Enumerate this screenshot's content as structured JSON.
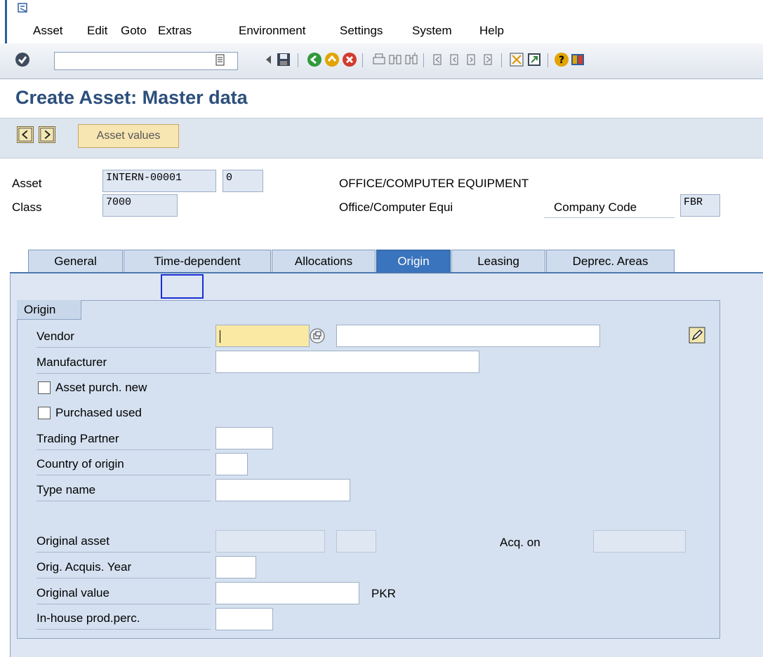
{
  "menu": {
    "items": [
      "Asset",
      "Edit",
      "Goto",
      "Extras",
      "Environment",
      "Settings",
      "System",
      "Help"
    ]
  },
  "toolbar": {
    "command_field_value": "",
    "icons": [
      "enter-icon",
      "command-menu-icon",
      "back-arrow-icon",
      "save-icon",
      "back-icon",
      "exit-icon",
      "cancel-icon",
      "print-icon",
      "find-icon",
      "find-next-icon",
      "first-page-icon",
      "previous-page-icon",
      "next-page-icon",
      "last-page-icon",
      "create-session-icon",
      "shortcut-icon",
      "help-icon",
      "customize-layout-icon"
    ]
  },
  "title": "Create Asset: Master data",
  "app_toolbar": {
    "asset_values_label": "Asset values"
  },
  "header": {
    "asset_label": "Asset",
    "asset_value": "INTERN-00001",
    "asset_subnumber": "0",
    "asset_description": "OFFICE/COMPUTER EQUIPMENT",
    "class_label": "Class",
    "class_value": "7000",
    "class_description": "Office/Computer Equi",
    "company_code_label": "Company Code",
    "company_code_value": "FBR"
  },
  "tabs": [
    {
      "label": "General",
      "active": false
    },
    {
      "label": "Time-dependent",
      "active": false
    },
    {
      "label": "Allocations",
      "active": false
    },
    {
      "label": "Origin",
      "active": true
    },
    {
      "label": "Leasing",
      "active": false
    },
    {
      "label": "Deprec. Areas",
      "active": false
    }
  ],
  "origin": {
    "group_title": "Origin",
    "vendor_label": "Vendor",
    "vendor_value": "",
    "vendor_name": "",
    "manufacturer_label": "Manufacturer",
    "manufacturer_value": "",
    "asset_purch_new_label": "Asset purch. new",
    "purchased_used_label": "Purchased used",
    "trading_partner_label": "Trading Partner",
    "country_of_origin_label": "Country of origin",
    "type_name_label": "Type name",
    "original_asset_label": "Original asset",
    "acq_on_label": "Acq. on",
    "orig_acquis_year_label": "Orig. Acquis. Year",
    "original_value_label": "Original value",
    "currency": "PKR",
    "inhouse_prod_label": "In-house prod.perc."
  },
  "colors": {
    "title": "#2c4f7c",
    "active_tab": "#3a74bc",
    "focus_field": "#fae9a3",
    "panel": "#dde6f2"
  }
}
